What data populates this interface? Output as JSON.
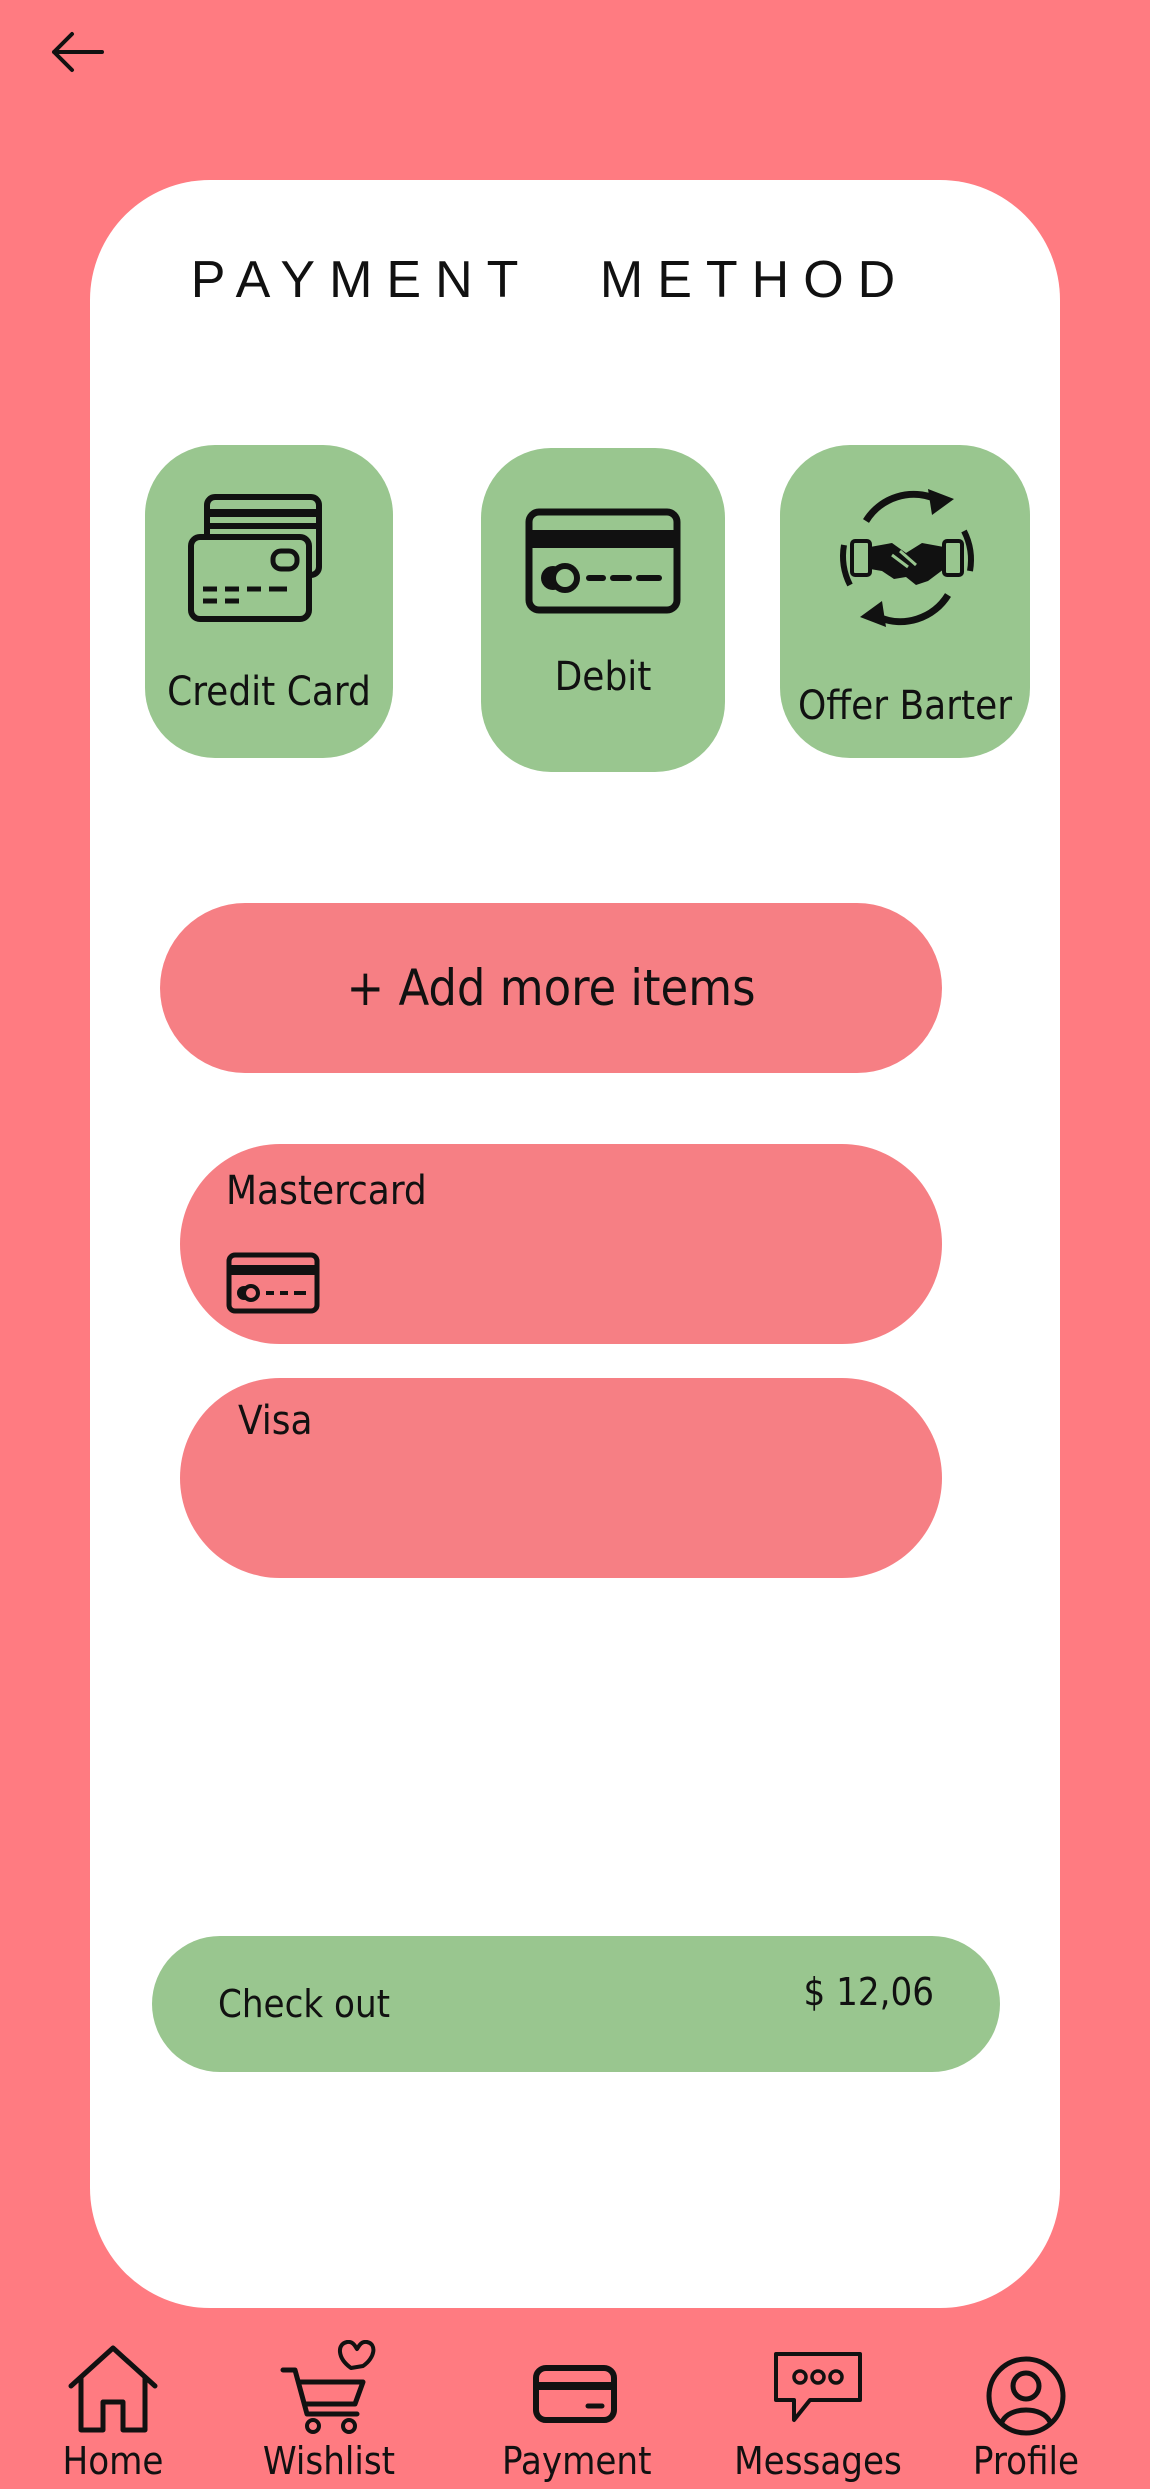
{
  "page": {
    "title": "PAYMENT   METHOD",
    "back_icon": "arrow-left-icon"
  },
  "methods": [
    {
      "label": "Credit Card",
      "icon": "credit-cards-icon"
    },
    {
      "label": "Debit",
      "icon": "debit-card-icon"
    },
    {
      "label": "Offer Barter",
      "icon": "barter-handshake-icon"
    }
  ],
  "add_items": {
    "label": "+ Add more items"
  },
  "saved_cards": [
    {
      "name": "Mastercard",
      "icon": "card-icon"
    },
    {
      "name": "Visa"
    }
  ],
  "checkout": {
    "label": "Check out",
    "amount": "$ 12,06"
  },
  "nav": [
    {
      "label": "Home",
      "icon": "home-icon"
    },
    {
      "label": "Wishlist",
      "icon": "cart-heart-icon"
    },
    {
      "label": "Payment",
      "icon": "wallet-card-icon"
    },
    {
      "label": "Messages",
      "icon": "chat-bubble-icon"
    },
    {
      "label": "Profile",
      "icon": "user-circle-icon"
    }
  ],
  "colors": {
    "background": "#ff7b81",
    "panel": "#ffffff",
    "accent_green": "#99c68f",
    "pill_pink": "#f67f84"
  }
}
